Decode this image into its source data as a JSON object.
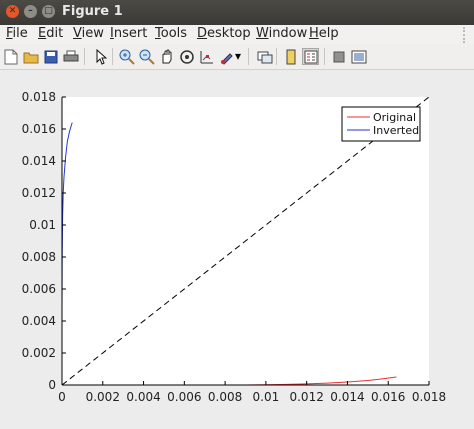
{
  "window": {
    "title": "Figure 1"
  },
  "menu": [
    "File",
    "Edit",
    "View",
    "Insert",
    "Tools",
    "Desktop",
    "Window",
    "Help"
  ],
  "chart_data": {
    "type": "line",
    "xlim": [
      0,
      0.018
    ],
    "ylim": [
      0,
      0.018
    ],
    "xticks": [
      "0",
      "0.002",
      "0.004",
      "0.006",
      "0.008",
      "0.01",
      "0.012",
      "0.014",
      "0.016",
      "0.018"
    ],
    "yticks": [
      "0",
      "0.002",
      "0.004",
      "0.006",
      "0.008",
      "0.01",
      "0.012",
      "0.014",
      "0.016",
      "0.018"
    ],
    "legend_position": "top-right",
    "series": [
      {
        "name": "Original",
        "color": "#e8312f",
        "x": [
          0.0051,
          0.006,
          0.007,
          0.008,
          0.009,
          0.01,
          0.011,
          0.012,
          0.013,
          0.014,
          0.015,
          0.0155,
          0.0164
        ],
        "y": [
          0.0,
          0.0,
          0.0,
          0.0,
          0.0,
          2e-05,
          4e-05,
          7e-05,
          0.00012,
          0.00019,
          0.00028,
          0.00035,
          0.0005
        ]
      },
      {
        "name": "Inverted",
        "color": "#2236d6",
        "x": [
          0.0,
          1e-05,
          3e-05,
          6e-05,
          0.0001,
          0.00017,
          0.00026,
          0.00038,
          0.0005
        ],
        "y": [
          0.0051,
          0.008,
          0.0105,
          0.012,
          0.013,
          0.0142,
          0.0152,
          0.0159,
          0.0164
        ]
      },
      {
        "name": "",
        "color": "#000000",
        "dashed": true,
        "x": [
          0,
          0.018
        ],
        "y": [
          0,
          0.018
        ]
      }
    ]
  }
}
